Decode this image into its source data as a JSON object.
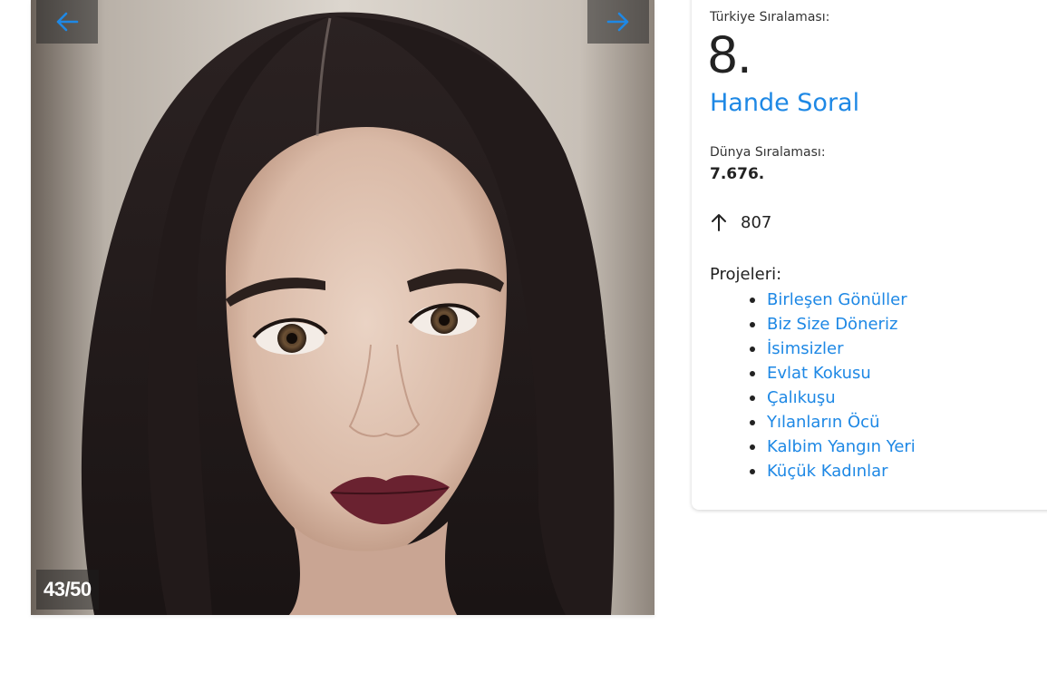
{
  "gallery": {
    "counter": "43/50",
    "prev_icon": "arrow-left-icon",
    "next_icon": "arrow-right-icon",
    "accent": "#1e88e5"
  },
  "profile": {
    "turkey_rank_label": "Türkiye Sıralaması:",
    "turkey_rank": "8.",
    "name": "Hande Soral",
    "world_rank_label": "Dünya Sıralaması:",
    "world_rank": "7.676.",
    "change_icon": "arrow-up-icon",
    "change_value": "807",
    "projects_label": "Projeleri:",
    "projects": [
      "Birleşen Gönüller",
      "Biz Size Döneriz",
      "İsimsizler",
      "Evlat Kokusu",
      "Çalıkuşu",
      "Yılanların Öcü",
      "Kalbim Yangın Yeri",
      "Küçük Kadınlar"
    ]
  }
}
